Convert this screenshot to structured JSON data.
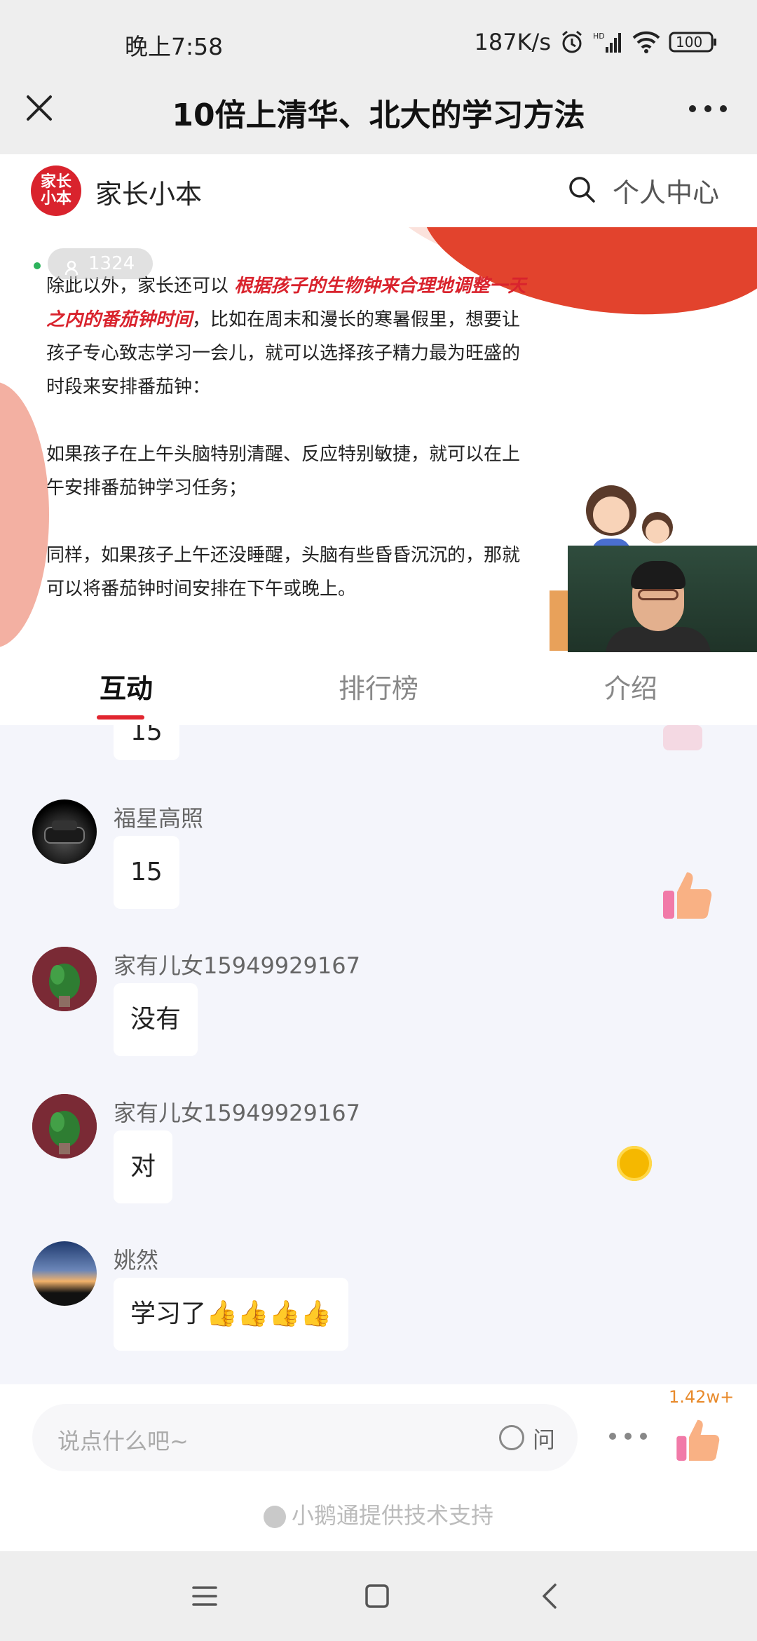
{
  "status_bar": {
    "time": "晚上7:58",
    "speed": "187K/s",
    "battery": "100"
  },
  "title_bar": {
    "title": "10倍上清华、北大的学习方法"
  },
  "brand": {
    "logo_text": "家长小本",
    "name": "家长小本",
    "personal_center": "个人中心"
  },
  "slide": {
    "viewer_count": "1324",
    "paragraph1_start": "除此以外，家长还可以",
    "paragraph1_emphasis": "根据孩子的生物钟来合理地调整一天之内的番茄钟时间",
    "paragraph1_rest": "，比如在周末和漫长的寒暑假里，想要让孩子专心致志学习一会儿，就可以选择孩子精力最为旺盛的时段来安排番茄钟：",
    "paragraph2": "如果孩子在上午头脑特别清醒、反应特别敏捷，就可以在上午安排番茄钟学习任务；",
    "paragraph3": "同样，如果孩子上午还没睡醒，头脑有些昏昏沉沉的，那就可以将番茄钟时间安排在下午或晚上。"
  },
  "tabs": [
    {
      "label": "互动",
      "active": true
    },
    {
      "label": "排行榜",
      "active": false
    },
    {
      "label": "介绍",
      "active": false
    }
  ],
  "chat": {
    "partial_message": "15",
    "messages": [
      {
        "nick": "福星高照",
        "text": "15"
      },
      {
        "nick": "家有儿女15949929167",
        "text": "没有"
      },
      {
        "nick": "家有儿女15949929167",
        "text": "对"
      },
      {
        "nick": "姚然",
        "text": "学习了👍👍👍👍"
      }
    ]
  },
  "input_bar": {
    "placeholder": "说点什么吧~",
    "ask_label": "问",
    "like_count": "1.42w+",
    "powered_by": "小鹅通提供技术支持"
  },
  "colors": {
    "brand_red": "#d9232d",
    "tab_indicator": "#e1252f",
    "chat_bg": "#f4f5fb",
    "like_count_orange": "#e88a2b"
  },
  "icons": {
    "close": "close-icon",
    "more": "more-icon",
    "search": "search-icon",
    "like": "thumbs-up-icon",
    "nav_menu": "menu-icon",
    "nav_home": "home-icon",
    "nav_back": "back-icon"
  }
}
